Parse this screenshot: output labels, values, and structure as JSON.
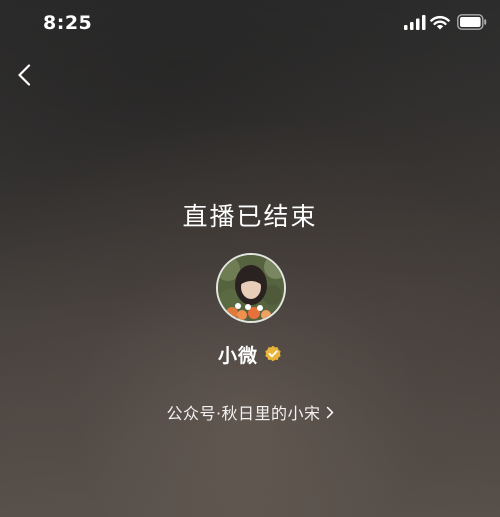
{
  "status_bar": {
    "time": "8:25",
    "icons": [
      "signal-icon",
      "wifi-icon",
      "battery-icon"
    ]
  },
  "nav": {
    "back_icon": "chevron-left-icon"
  },
  "live": {
    "title": "直播已结束"
  },
  "host": {
    "avatar": "avatar-photo",
    "name": "小微",
    "verified_icon": "verified-badge-icon",
    "verified_color": "#e9b43a"
  },
  "account": {
    "text": "公众号·秋日里的小宋",
    "link_icon": "chevron-right-icon"
  },
  "colors": {
    "text": "#ffffff",
    "background": "#3a3633"
  }
}
